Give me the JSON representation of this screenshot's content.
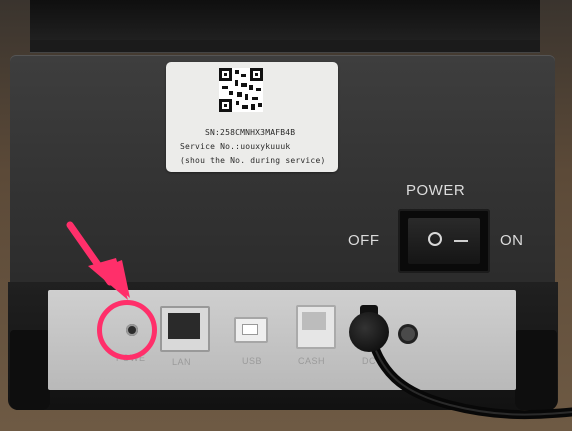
{
  "label": {
    "serial": "SN:258CMNHX3MAFB4B",
    "service_no": "Service No.:uouxykuuuk",
    "service_note": "(shou the No. during service)"
  },
  "power": {
    "title": "POWER",
    "off_label": "OFF",
    "on_label": "ON"
  },
  "ports": {
    "power_label": "POWE",
    "lan_label": "LAN",
    "usb_label": "USB",
    "cash_label": "CASH",
    "dc_label": "DC"
  },
  "annotation": {
    "color": "#ff2f6a"
  }
}
